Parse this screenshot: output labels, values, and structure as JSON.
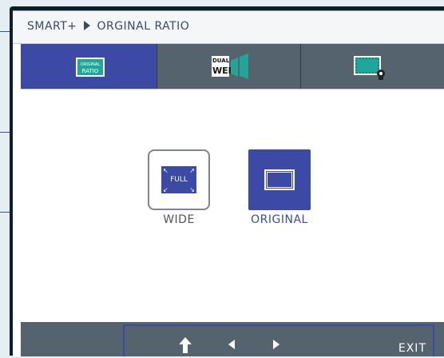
{
  "header": {
    "path_root": "SMART+",
    "separator_icon": "right-triangle-icon",
    "path_item": "ORGINAL RATIO"
  },
  "tabs": [
    {
      "icon": "original-ratio-icon",
      "line1": "ORIGINAL",
      "line2": "RATIO",
      "active": true
    },
    {
      "icon": "dual-web-icon",
      "line1": "DUAL",
      "line2": "WEB",
      "active": false
    },
    {
      "icon": "screen-camera-icon",
      "active": false
    }
  ],
  "options": [
    {
      "label": "WIDE",
      "icon_text": "FULL",
      "selected": false
    },
    {
      "label": "ORIGINAL",
      "selected": true
    }
  ],
  "footer": {
    "buttons": [
      "back-icon",
      "left-arrow-icon",
      "right-arrow-icon"
    ],
    "exit_label": "EXIT"
  },
  "colors": {
    "accent": "#3c4aa6",
    "tab_inactive": "#55636e",
    "frame": "#0f1f2a"
  }
}
